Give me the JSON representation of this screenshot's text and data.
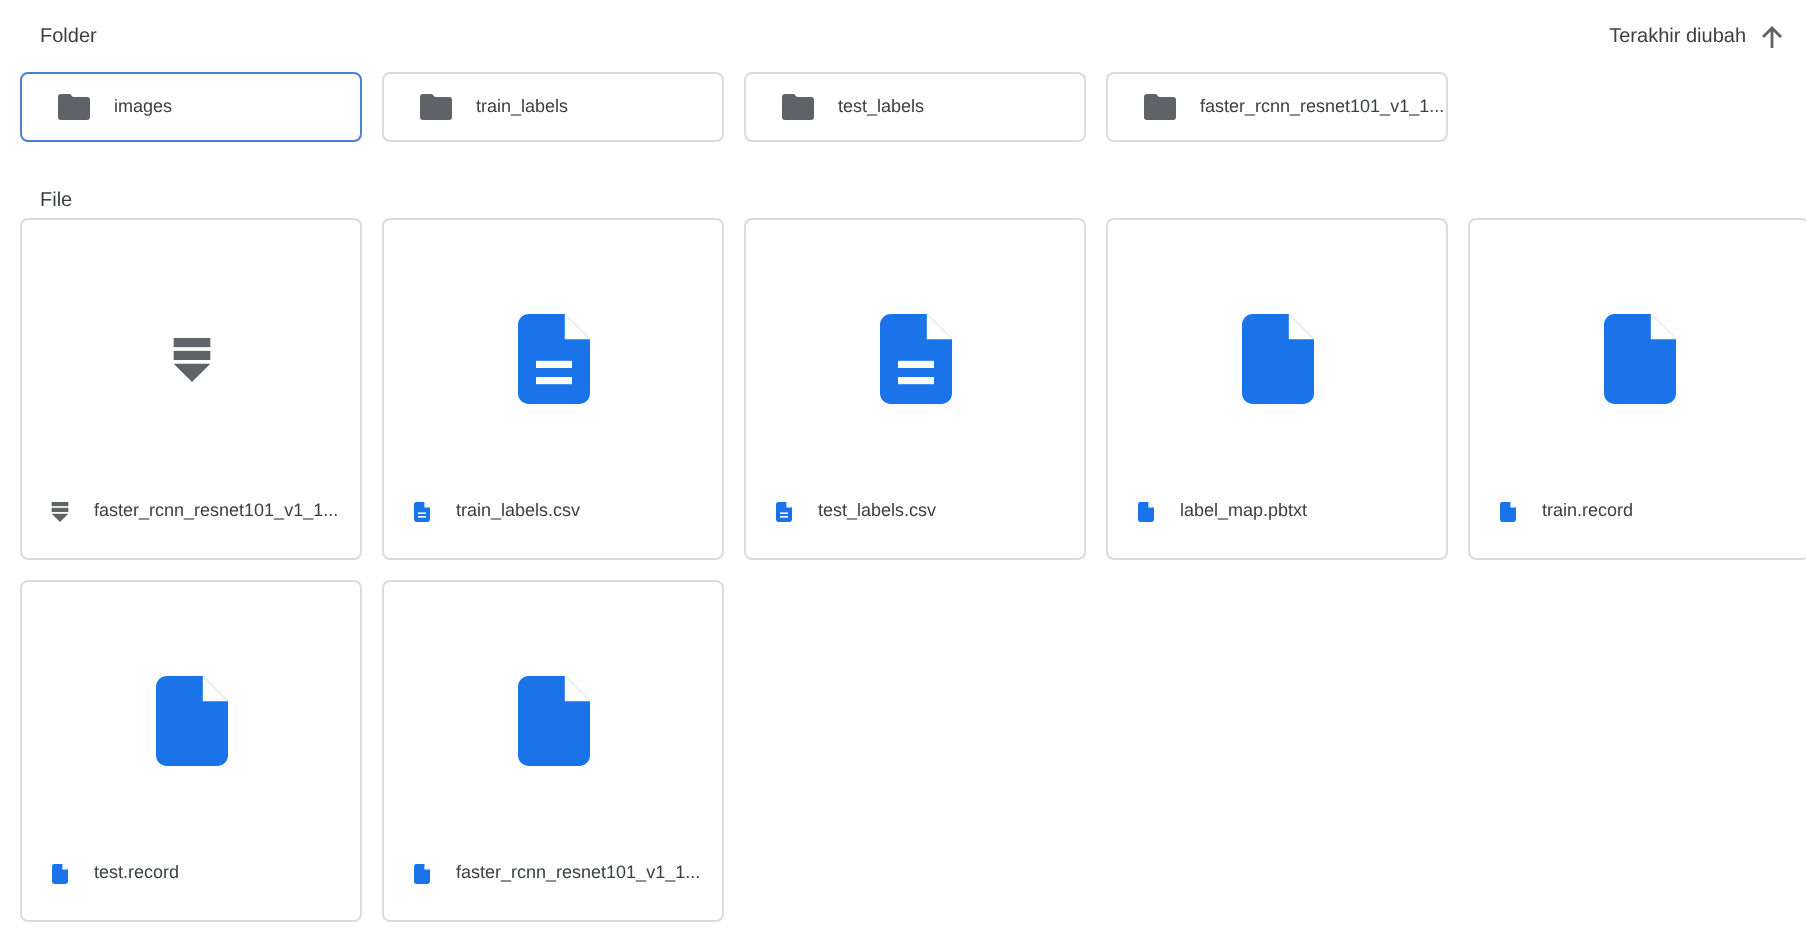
{
  "folder_section": {
    "label": "Folder"
  },
  "sort": {
    "label": "Terakhir diubah"
  },
  "folders": [
    {
      "name": "images",
      "selected": true
    },
    {
      "name": "train_labels",
      "selected": false
    },
    {
      "name": "test_labels",
      "selected": false
    },
    {
      "name": "faster_rcnn_resnet101_v1_1...",
      "selected": false
    }
  ],
  "file_section": {
    "label": "File"
  },
  "files": [
    {
      "name": "faster_rcnn_resnet101_v1_1...",
      "kind": "archive"
    },
    {
      "name": "train_labels.csv",
      "kind": "doc"
    },
    {
      "name": "test_labels.csv",
      "kind": "doc"
    },
    {
      "name": "label_map.pbtxt",
      "kind": "blank"
    },
    {
      "name": "train.record",
      "kind": "blank"
    },
    {
      "name": "test.record",
      "kind": "blank"
    },
    {
      "name": "faster_rcnn_resnet101_v1_1...",
      "kind": "blank"
    }
  ]
}
